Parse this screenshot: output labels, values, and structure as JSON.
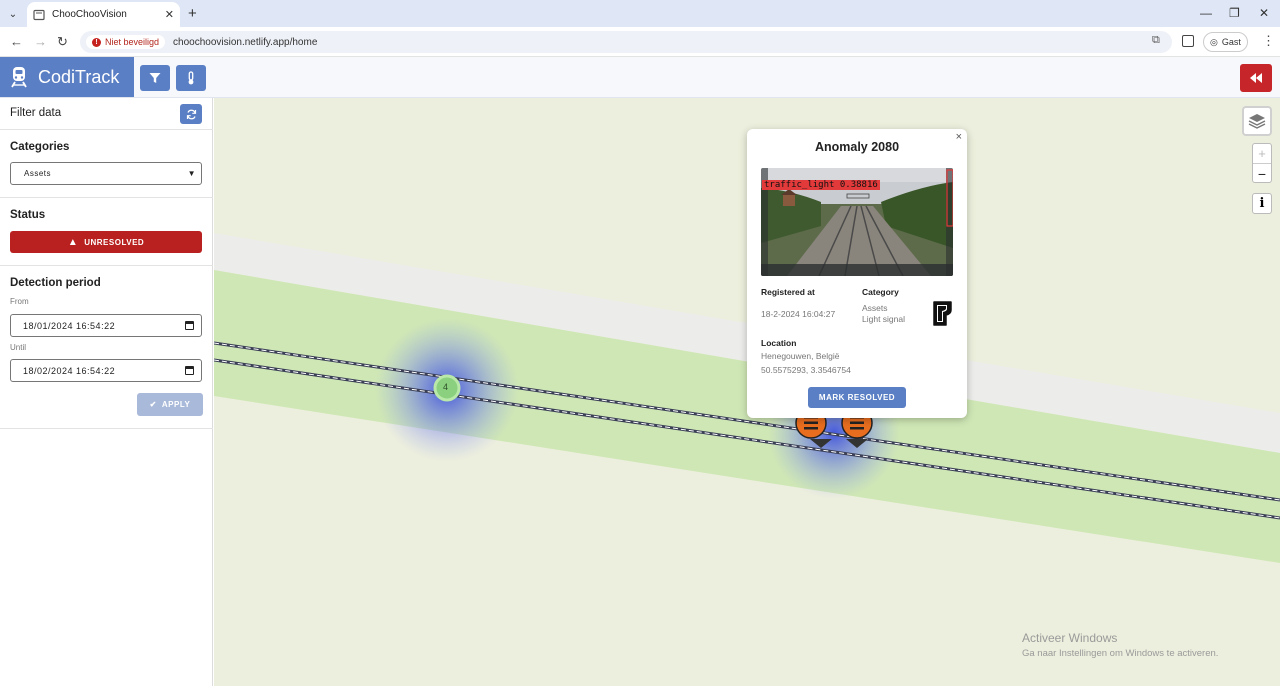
{
  "browser": {
    "tab_title": "ChooChooVision",
    "security_label": "Niet beveiligd",
    "url": "choochoovision.netlify.app/home",
    "profile_label": "Gast"
  },
  "app": {
    "brand_name": "CodiTrack",
    "accent_color": "#5b7fc4",
    "danger_color": "#c6262a"
  },
  "sidebar": {
    "title": "Filter data",
    "categories_label": "Categories",
    "category_selected": "Assets",
    "status_label": "Status",
    "status_value": "UNRESOLVED",
    "period_label": "Detection period",
    "from_label": "From",
    "from_value": "18/01/2024 16:54:22",
    "until_label": "Until",
    "until_value": "18/02/2024 16:54:22",
    "apply_label": "APPLY"
  },
  "map": {
    "cluster_count": "4",
    "zoom_in": "+",
    "zoom_out": "−",
    "info": "i",
    "watermark_title": "Activeer Windows",
    "watermark_sub": "Ga naar Instellingen om Windows te activeren."
  },
  "popup": {
    "title": "Anomaly 2080",
    "detection_label": "traffic_light  0.38816",
    "registered_label": "Registered at",
    "registered_value": "18-2-2024 16:04:27",
    "category_label": "Category",
    "category_line1": "Assets",
    "category_line2": "Light signal",
    "location_label": "Location",
    "location_line1": "Henegouwen, België",
    "location_line2": "50.5575293, 3.3546754",
    "resolve_label": "MARK RESOLVED"
  }
}
